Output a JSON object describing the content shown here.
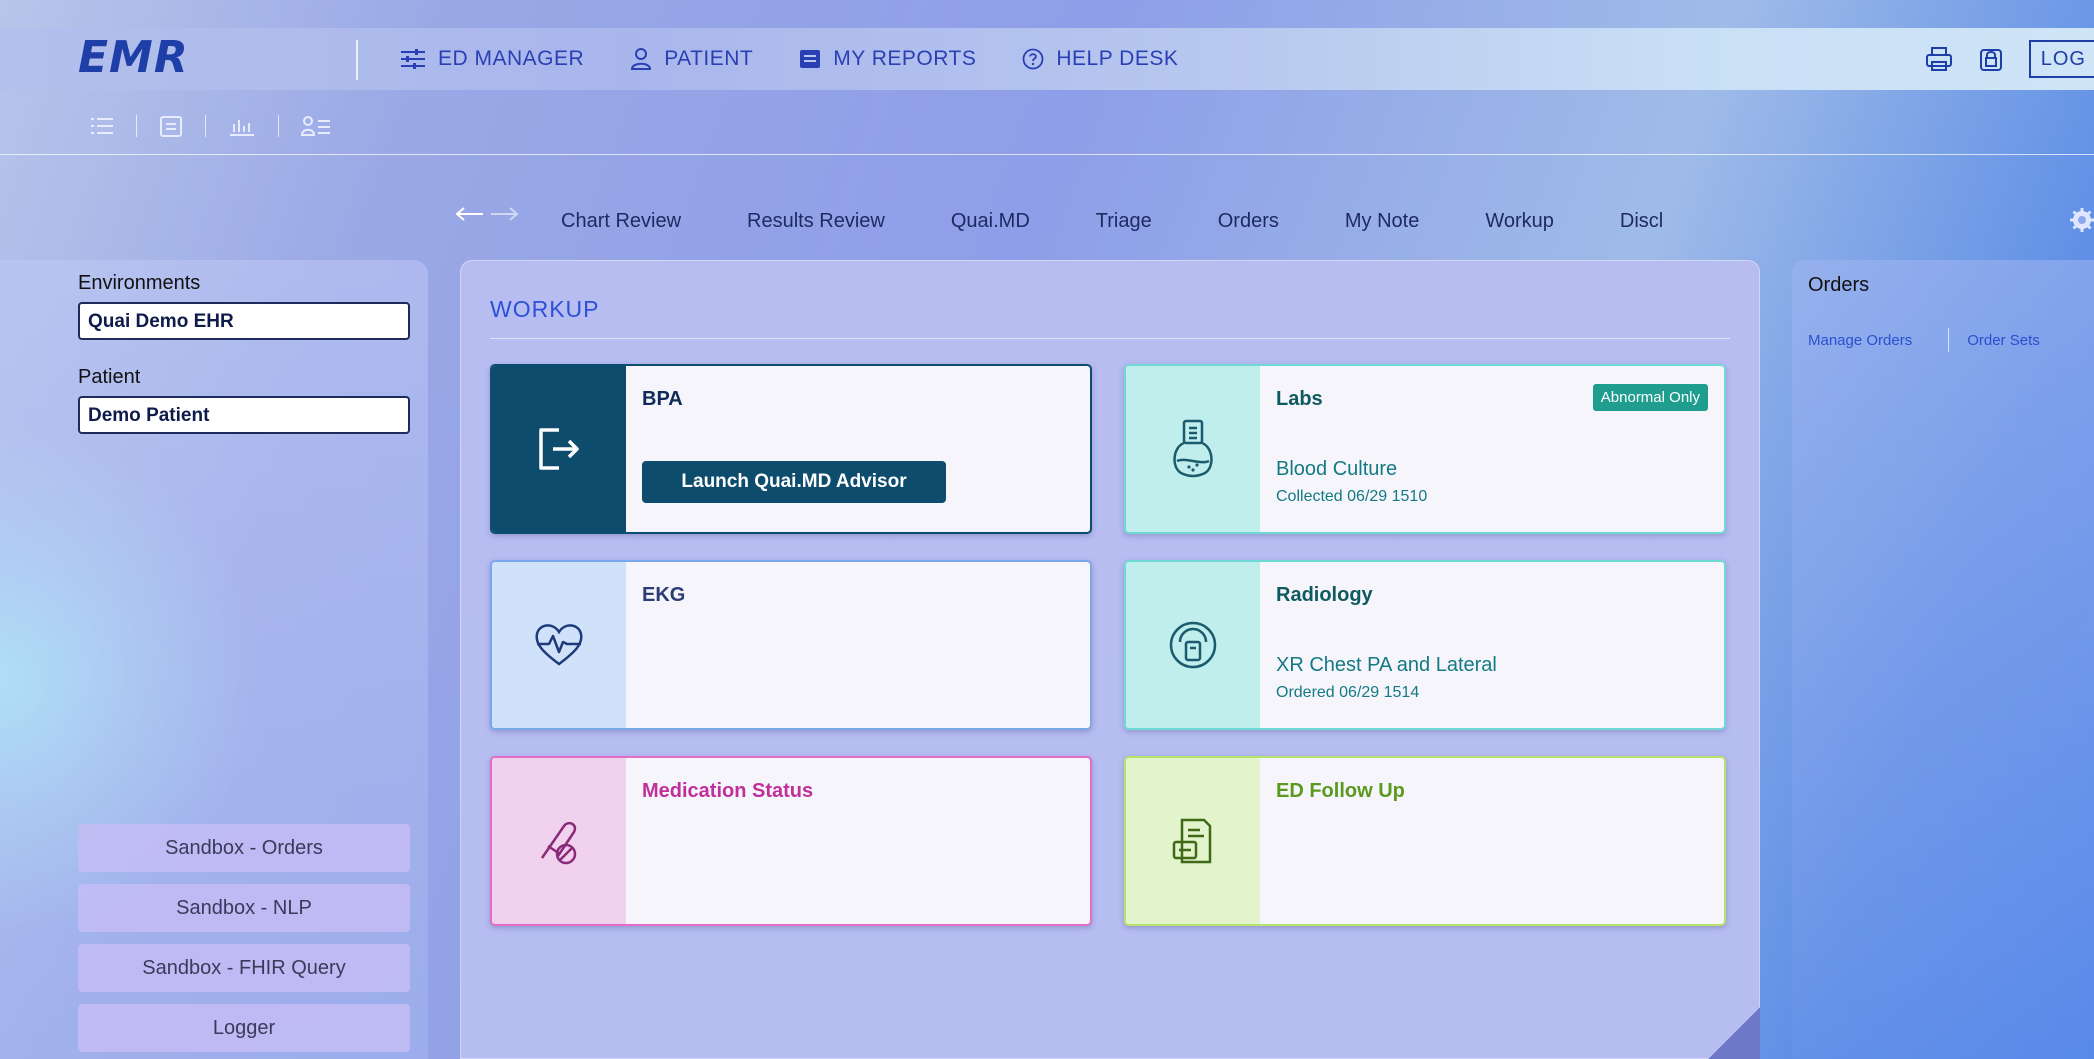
{
  "app": {
    "logo": "EMR"
  },
  "topnav": {
    "items": [
      {
        "label": "ED MANAGER",
        "icon": "sliders-icon"
      },
      {
        "label": "PATIENT",
        "icon": "person-icon"
      },
      {
        "label": "MY REPORTS",
        "icon": "document-icon"
      },
      {
        "label": "HELP DESK",
        "icon": "help-icon"
      }
    ],
    "logout_label": "LOG"
  },
  "activity_tabs": [
    "Chart Review",
    "Results Review",
    "Quai.MD",
    "Triage",
    "Orders",
    "My Note",
    "Workup",
    "Discl"
  ],
  "sidebar": {
    "environments_label": "Environments",
    "environment_value": "Quai Demo EHR",
    "patient_label": "Patient",
    "patient_value": "Demo Patient",
    "buttons": [
      "Sandbox - Orders",
      "Sandbox - NLP",
      "Sandbox - FHIR Query",
      "Logger"
    ]
  },
  "workup": {
    "title": "WORKUP",
    "cards": {
      "bpa": {
        "title": "BPA",
        "button": "Launch Quai.MD Advisor"
      },
      "labs": {
        "title": "Labs",
        "badge": "Abnormal Only",
        "line1": "Blood Culture",
        "line2": "Collected 06/29 1510"
      },
      "ekg": {
        "title": "EKG"
      },
      "radiology": {
        "title": "Radiology",
        "line1": "XR Chest PA and Lateral",
        "line2": "Ordered 06/29 1514"
      },
      "medication": {
        "title": "Medication Status"
      },
      "followup": {
        "title": "ED Follow Up"
      }
    }
  },
  "orders_panel": {
    "title": "Orders",
    "links": [
      "Manage Orders",
      "Order Sets"
    ]
  },
  "colors": {
    "primary": "#2a3fb4",
    "bpa_accent": "#0e4c6d",
    "labs_accent": "#1f9e8f",
    "ekg_accent": "#6e9be0",
    "medication_accent": "#c0309a",
    "followup_accent": "#5a9a1e"
  }
}
